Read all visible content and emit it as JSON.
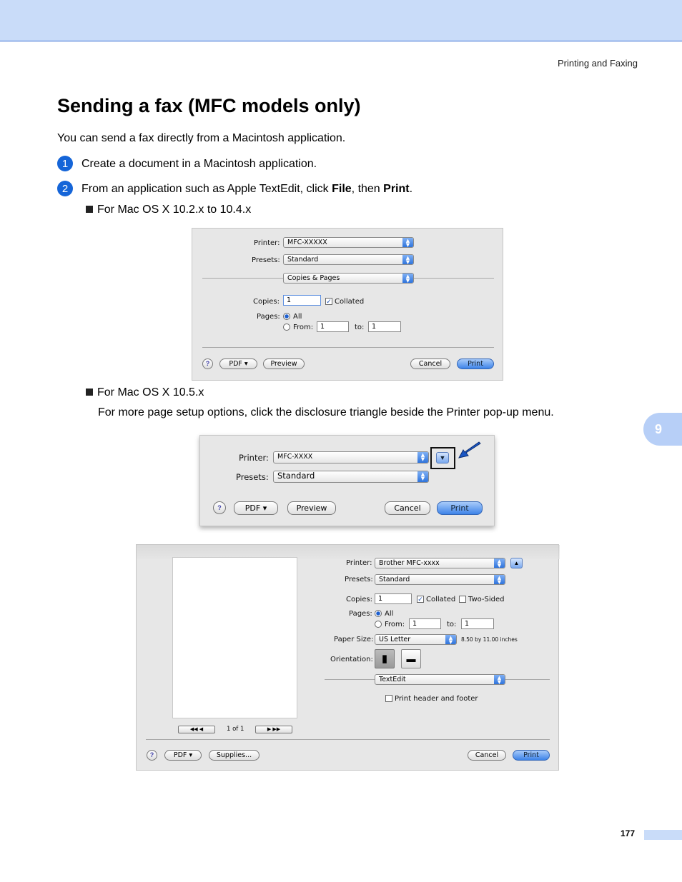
{
  "header": {
    "section": "Printing and Faxing"
  },
  "title": "Sending a fax (MFC models only)",
  "intro": "You can send a fax directly from a Macintosh application.",
  "steps": [
    {
      "num": "1",
      "text": "Create a document in a Macintosh application."
    },
    {
      "num": "2",
      "pre": "From an application such as Apple TextEdit, click ",
      "b1": "File",
      "mid": ", then ",
      "b2": "Print",
      "post": "."
    }
  ],
  "bullets": [
    {
      "text": "For Mac OS X 10.2.x to 10.4.x"
    },
    {
      "text": "For Mac OS X 10.5.x",
      "sub": "For more page setup options, click the disclosure triangle beside the Printer pop-up menu."
    }
  ],
  "dialog1": {
    "printer_label": "Printer:",
    "printer": "MFC-XXXXX",
    "presets_label": "Presets:",
    "presets": "Standard",
    "panel": "Copies & Pages",
    "copies_label": "Copies:",
    "copies": "1",
    "collated": "Collated",
    "pages_label": "Pages:",
    "all": "All",
    "from_label": "From:",
    "from": "1",
    "to_label": "to:",
    "to": "1",
    "help": "?",
    "pdf": "PDF ▾",
    "preview": "Preview",
    "cancel": "Cancel",
    "print": "Print"
  },
  "dialog2": {
    "printer_label": "Printer:",
    "printer": "MFC-XXXX",
    "presets_label": "Presets:",
    "presets": "Standard",
    "help": "?",
    "pdf": "PDF ▾",
    "preview": "Preview",
    "cancel": "Cancel",
    "print": "Print"
  },
  "dialog3": {
    "printer_label": "Printer:",
    "printer": "Brother MFC-xxxx",
    "presets_label": "Presets:",
    "presets": "Standard",
    "copies_label": "Copies:",
    "copies": "1",
    "collated": "Collated",
    "two_sided": "Two-Sided",
    "pages_label": "Pages:",
    "all": "All",
    "from_label": "From:",
    "from": "1",
    "to_label": "to:",
    "to": "1",
    "paper_label": "Paper Size:",
    "paper": "US Letter",
    "paper_dim": "8.50 by 11.00 inches",
    "orientation_label": "Orientation:",
    "app": "TextEdit",
    "header_footer": "Print header and footer",
    "page_count": "1 of 1",
    "help": "?",
    "pdf": "PDF ▾",
    "supplies": "Supplies...",
    "cancel": "Cancel",
    "print": "Print"
  },
  "chapter_tab": "9",
  "page_number": "177",
  "colors": {
    "band": "#c9dcf9",
    "step": "#1565d8",
    "tab": "#b7cff7",
    "arrow": "#1a56c4"
  }
}
